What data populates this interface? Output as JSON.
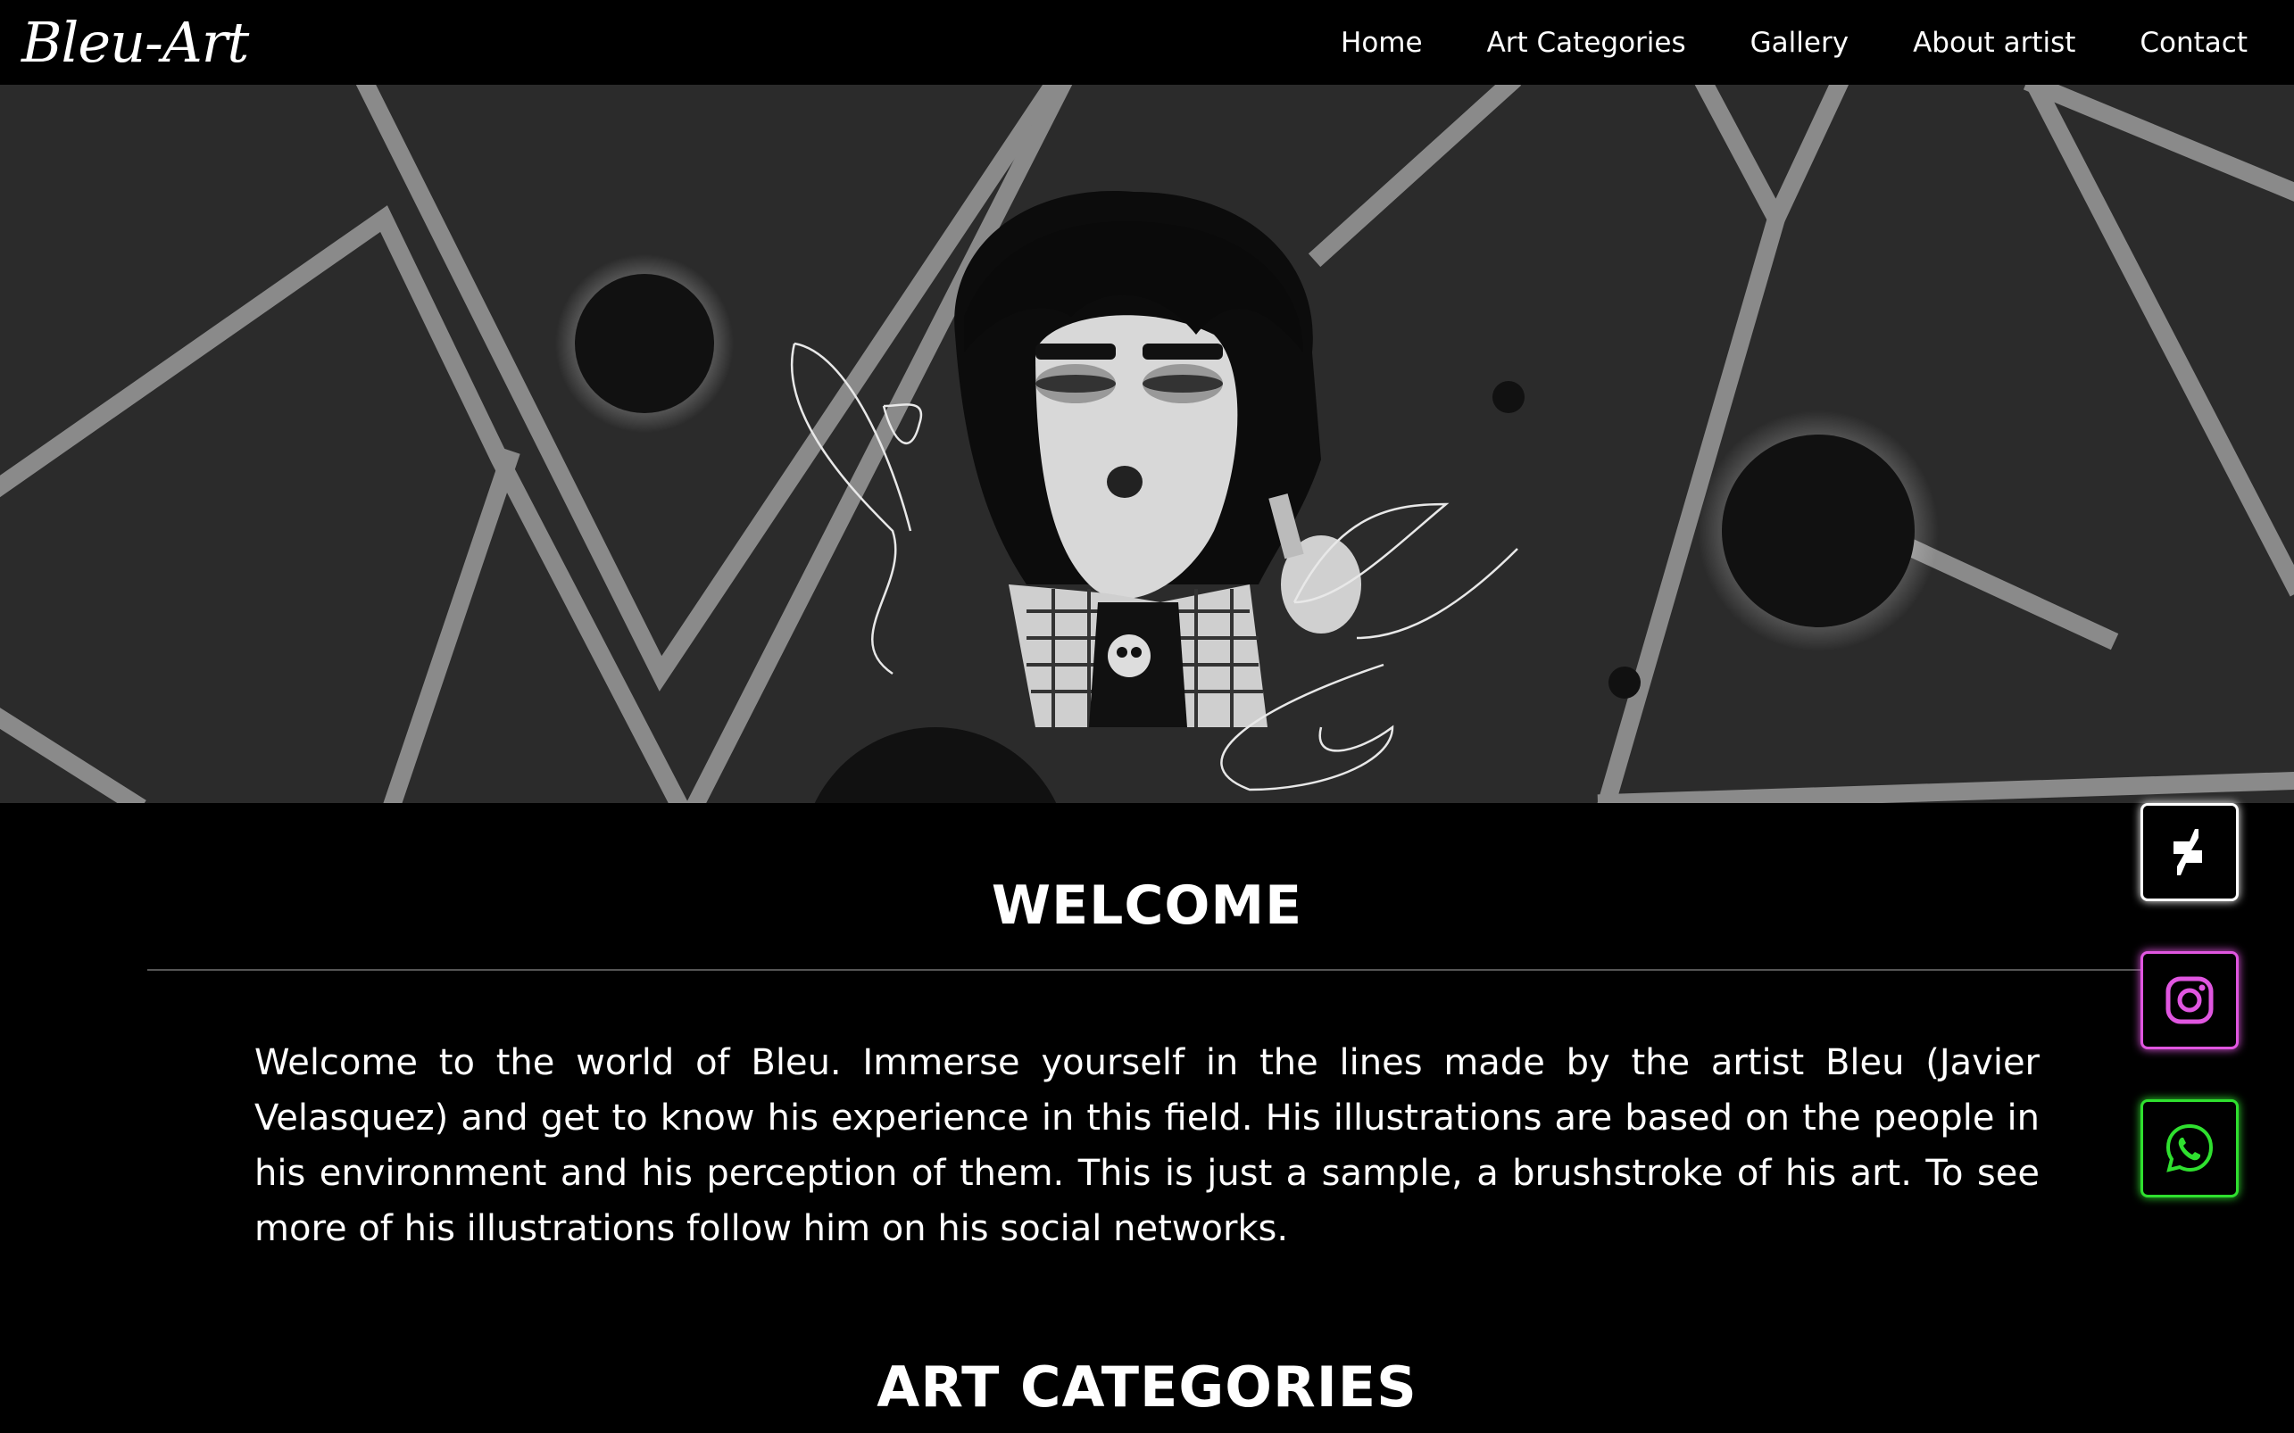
{
  "brand": {
    "logo_text": "Bleu-Art"
  },
  "nav": {
    "items": [
      {
        "label": "Home"
      },
      {
        "label": "Art Categories"
      },
      {
        "label": "Gallery"
      },
      {
        "label": "About artist"
      },
      {
        "label": "Contact"
      }
    ]
  },
  "hero": {
    "image_alt": "Black and white illustration of a character with black hair, plaid shirt and skull t-shirt on a geometric background"
  },
  "welcome": {
    "title": "WELCOME",
    "text": "Welcome to the world of Bleu. Immerse yourself in the lines made by the artist Bleu (Javier Velasquez) and get to know his experience in this field. His illustrations are based on the people in his environment and his perception of them. This is just a sample, a brushstroke of his art. To see more of his illustrations follow him on his social networks."
  },
  "categories": {
    "title": "ART CATEGORIES"
  },
  "social": {
    "items": [
      {
        "icon": "deviantart-icon",
        "color": "#ffffff"
      },
      {
        "icon": "instagram-icon",
        "color": "#e056e0"
      },
      {
        "icon": "whatsapp-icon",
        "color": "#2fe02f"
      }
    ]
  },
  "colors": {
    "background": "#000000",
    "hero_background": "#2b2b2b",
    "hero_lines": "#8a8a8a",
    "text": "#ffffff"
  }
}
